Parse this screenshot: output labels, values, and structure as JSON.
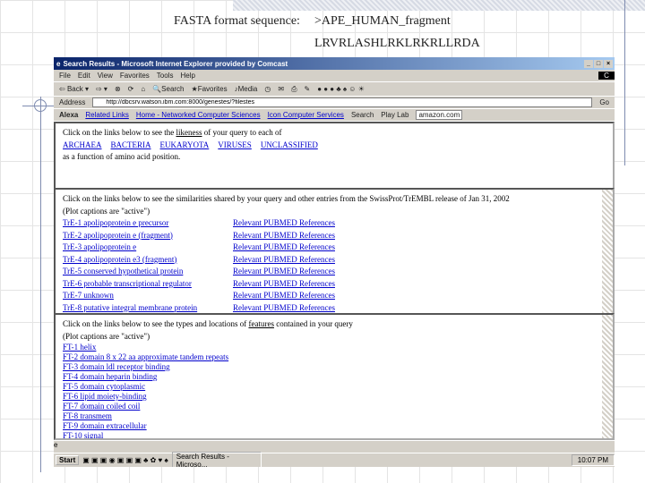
{
  "slide": {
    "label": "FASTA format sequence:",
    "header": ">APE_HUMAN_fragment",
    "sequence": "LRVRLASHLRKLRKRLLRDA"
  },
  "browser": {
    "title": "Search Results - Microsoft Internet Explorer provided by Comcast",
    "menu": [
      "File",
      "Edit",
      "View",
      "Favorites",
      "Tools",
      "Help"
    ],
    "toolbar": [
      "Back",
      "Search",
      "Favorites",
      "Media"
    ],
    "address_label": "Address",
    "url": "http://dbcsrv.watson.ibm.com:8000/genestes/?filestes",
    "go": "Go",
    "links_bar": [
      "Alexa",
      "Related Links",
      "Home - Networked Computer Sciences",
      "Icon Computer Services",
      "Search",
      "Play Lab",
      "amazon.com"
    ],
    "frame1": {
      "intro": "Click on the links below to see the ",
      "intro_link": "likeness",
      "intro_end": " of your query to each of",
      "links": [
        "ARCHAEA",
        "BACTERIA",
        "EUKARYOTA",
        "VIRUSES",
        "UNCLASSIFIED"
      ],
      "outro": "as a function of amino acid position."
    },
    "frame2": {
      "intro": "Click on the links below to see the similarities shared by your query and other entries from the SwissProt/TrEMBL release of Jan 31, 2002",
      "caption": "(Plot captions are \"active\")",
      "rows": [
        [
          "TrE-1 apolipoprotein e precursor",
          "Relevant PUBMED References"
        ],
        [
          "TrE-2 apolipoprotein e (fragment)",
          "Relevant PUBMED References"
        ],
        [
          "TrE-3 apolipoprotein e",
          "Relevant PUBMED References"
        ],
        [
          "TrE-4 apolipoprotein e3 (fragment)",
          "Relevant PUBMED References"
        ],
        [
          "TrE-5 conserved hypothetical protein",
          "Relevant PUBMED References"
        ],
        [
          "TrE-6 probable transcriptional regulator",
          "Relevant PUBMED References"
        ],
        [
          "TrE-7 unknown",
          "Relevant PUBMED References"
        ],
        [
          "TrE-8 putative integral membrane protein",
          "Relevant PUBMED References"
        ]
      ]
    },
    "frame3": {
      "intro": "Click on the links below to see the types and locations of ",
      "intro_link": "features",
      "intro_end": " contained in your query",
      "caption": "(Plot captions are \"active\")",
      "items": [
        "FT-1 helix",
        "FT-2 domain 8 x 22 aa approximate tandem repeats",
        "FT-3 domain ldl receptor binding",
        "FT-4 domain heparin binding",
        "FT-5 domain cytoplasmic",
        "FT-6 lipid moiety-binding",
        "FT-7 domain coiled coil",
        "FT-8 transmem",
        "FT-9 domain extracellular",
        "FT-10 signal"
      ]
    },
    "taskbar": {
      "start": "Start",
      "task": "Search Results - Microso...",
      "clock": "10:07 PM"
    }
  }
}
